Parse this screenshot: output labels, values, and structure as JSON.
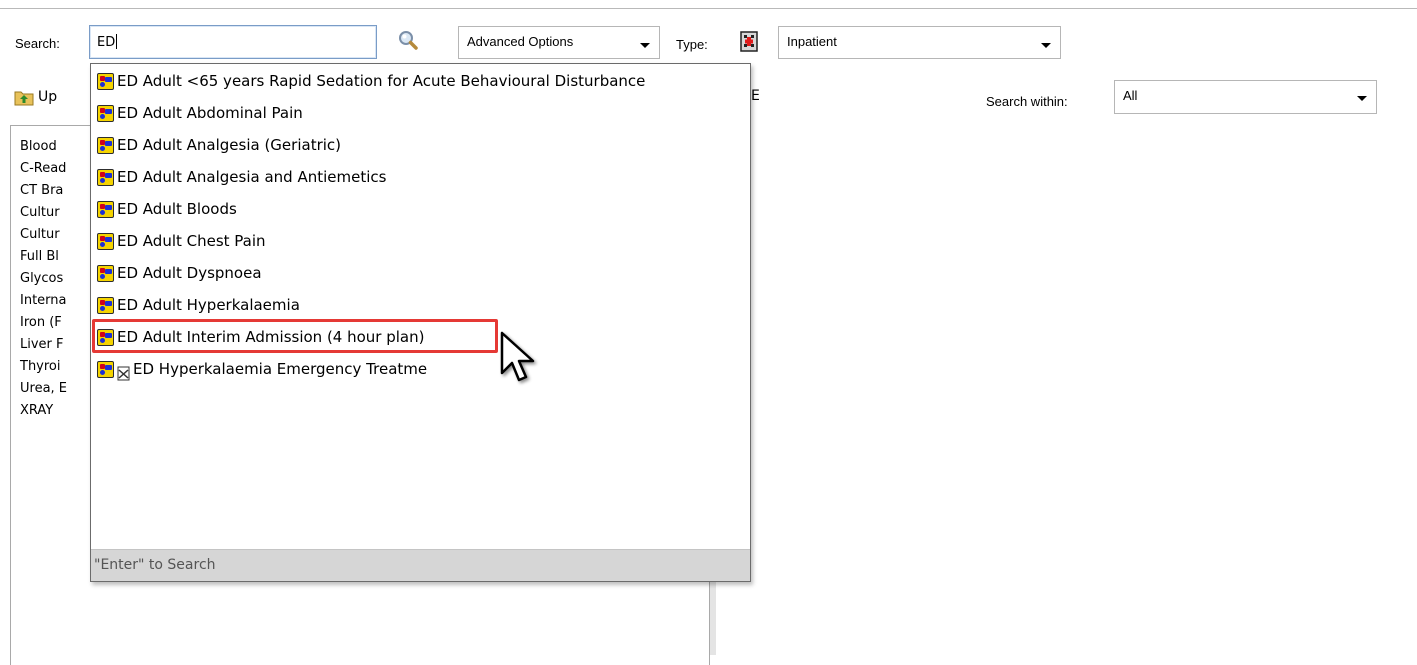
{
  "toolbar": {
    "search_label": "Search:",
    "search_value": "ED",
    "advanced_options": "Advanced Options",
    "type_label": "Type:",
    "type_value": "Inpatient",
    "up_label": "Up",
    "partial_tab_text": "E",
    "search_within_label": "Search within:",
    "search_within_value": "All"
  },
  "tree_items": [
    "Blood",
    "C-Read",
    "CT Bra",
    "Cultur",
    "Cultur",
    "Full Bl",
    "Glycos",
    "Interna",
    "Iron (F",
    "Liver F",
    "Thyroi",
    "Urea, E",
    "XRAY"
  ],
  "dropdown": {
    "items": [
      "ED Adult <65 years Rapid Sedation for Acute Behavioural Disturbance",
      "ED Adult Abdominal Pain",
      "ED Adult Analgesia (Geriatric)",
      "ED Adult Analgesia and Antiemetics",
      "ED Adult Bloods",
      "ED Adult Chest Pain",
      "ED Adult Dyspnoea",
      "ED Adult Hyperkalaemia",
      "ED Adult Interim Admission (4 hour plan)",
      "ED Hyperkalaemia Emergency Treatme"
    ],
    "highlighted_index": 8,
    "footer": "\"Enter\" to Search"
  },
  "icons": {
    "search": "magnifier-icon",
    "type": "inpatient-building-icon",
    "up": "up-folder-icon",
    "powerplan": "powerplan-icon"
  },
  "colors": {
    "highlight": "#e53935",
    "input_border": "#7a9cc7",
    "footer_bg": "#d6d6d6"
  }
}
